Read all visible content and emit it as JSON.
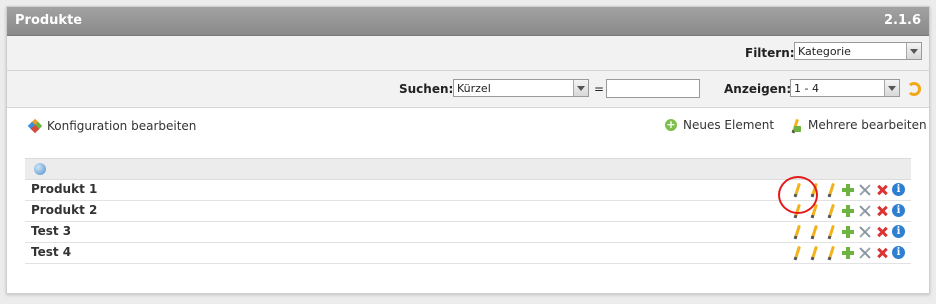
{
  "panel": {
    "title": "Produkte",
    "version": "2.1.6"
  },
  "filter": {
    "label": "Filtern:",
    "selected": "Kategorie"
  },
  "search": {
    "label": "Suchen:",
    "field_selected": "Kürzel",
    "equals": "=",
    "value": "",
    "show_label": "Anzeigen:",
    "show_selected": "1 - 4"
  },
  "actions": {
    "config": "Konfiguration bearbeiten",
    "new_element": "Neues Element",
    "bulk_edit": "Mehrere bearbeiten"
  },
  "rows": [
    {
      "name": "Produkt 1"
    },
    {
      "name": "Produkt 2"
    },
    {
      "name": "Test 3"
    },
    {
      "name": "Test 4"
    }
  ],
  "row_icons": [
    "pencil-icon",
    "pencil-icon",
    "pencil-icon",
    "add-icon",
    "tools-icon",
    "delete-icon",
    "info-icon"
  ],
  "colors": {
    "titlebar": "#8e8e8e",
    "highlight": "#e21a1a",
    "add": "#6cb33f",
    "delete": "#d33333",
    "info": "#2f7fd0"
  }
}
